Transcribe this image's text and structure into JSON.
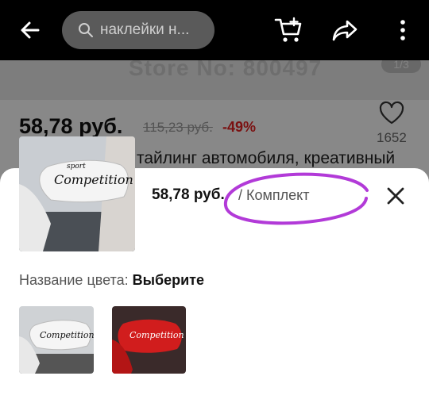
{
  "header": {
    "search_text": "наклейки н...",
    "icons": [
      "back-arrow-icon",
      "search-icon",
      "cart-icon",
      "share-icon",
      "more-vertical-icon"
    ]
  },
  "product": {
    "store_watermark": "Store No: 800497",
    "image_counter": "1/3",
    "price": "58,78 руб.",
    "old_price": "115,23 руб.",
    "discount": "-49%",
    "likes": "1652",
    "title": "тайлинг автомобиля, креативный"
  },
  "sheet": {
    "price": "58,78 руб.",
    "unit": "/ Комплект",
    "color_label": "Название цвета: ",
    "color_value": "Выберите",
    "options": [
      "white-variant",
      "red-variant"
    ]
  },
  "colors": {
    "accent_red": "#e02020",
    "annotation_purple": "#b23ad8"
  }
}
